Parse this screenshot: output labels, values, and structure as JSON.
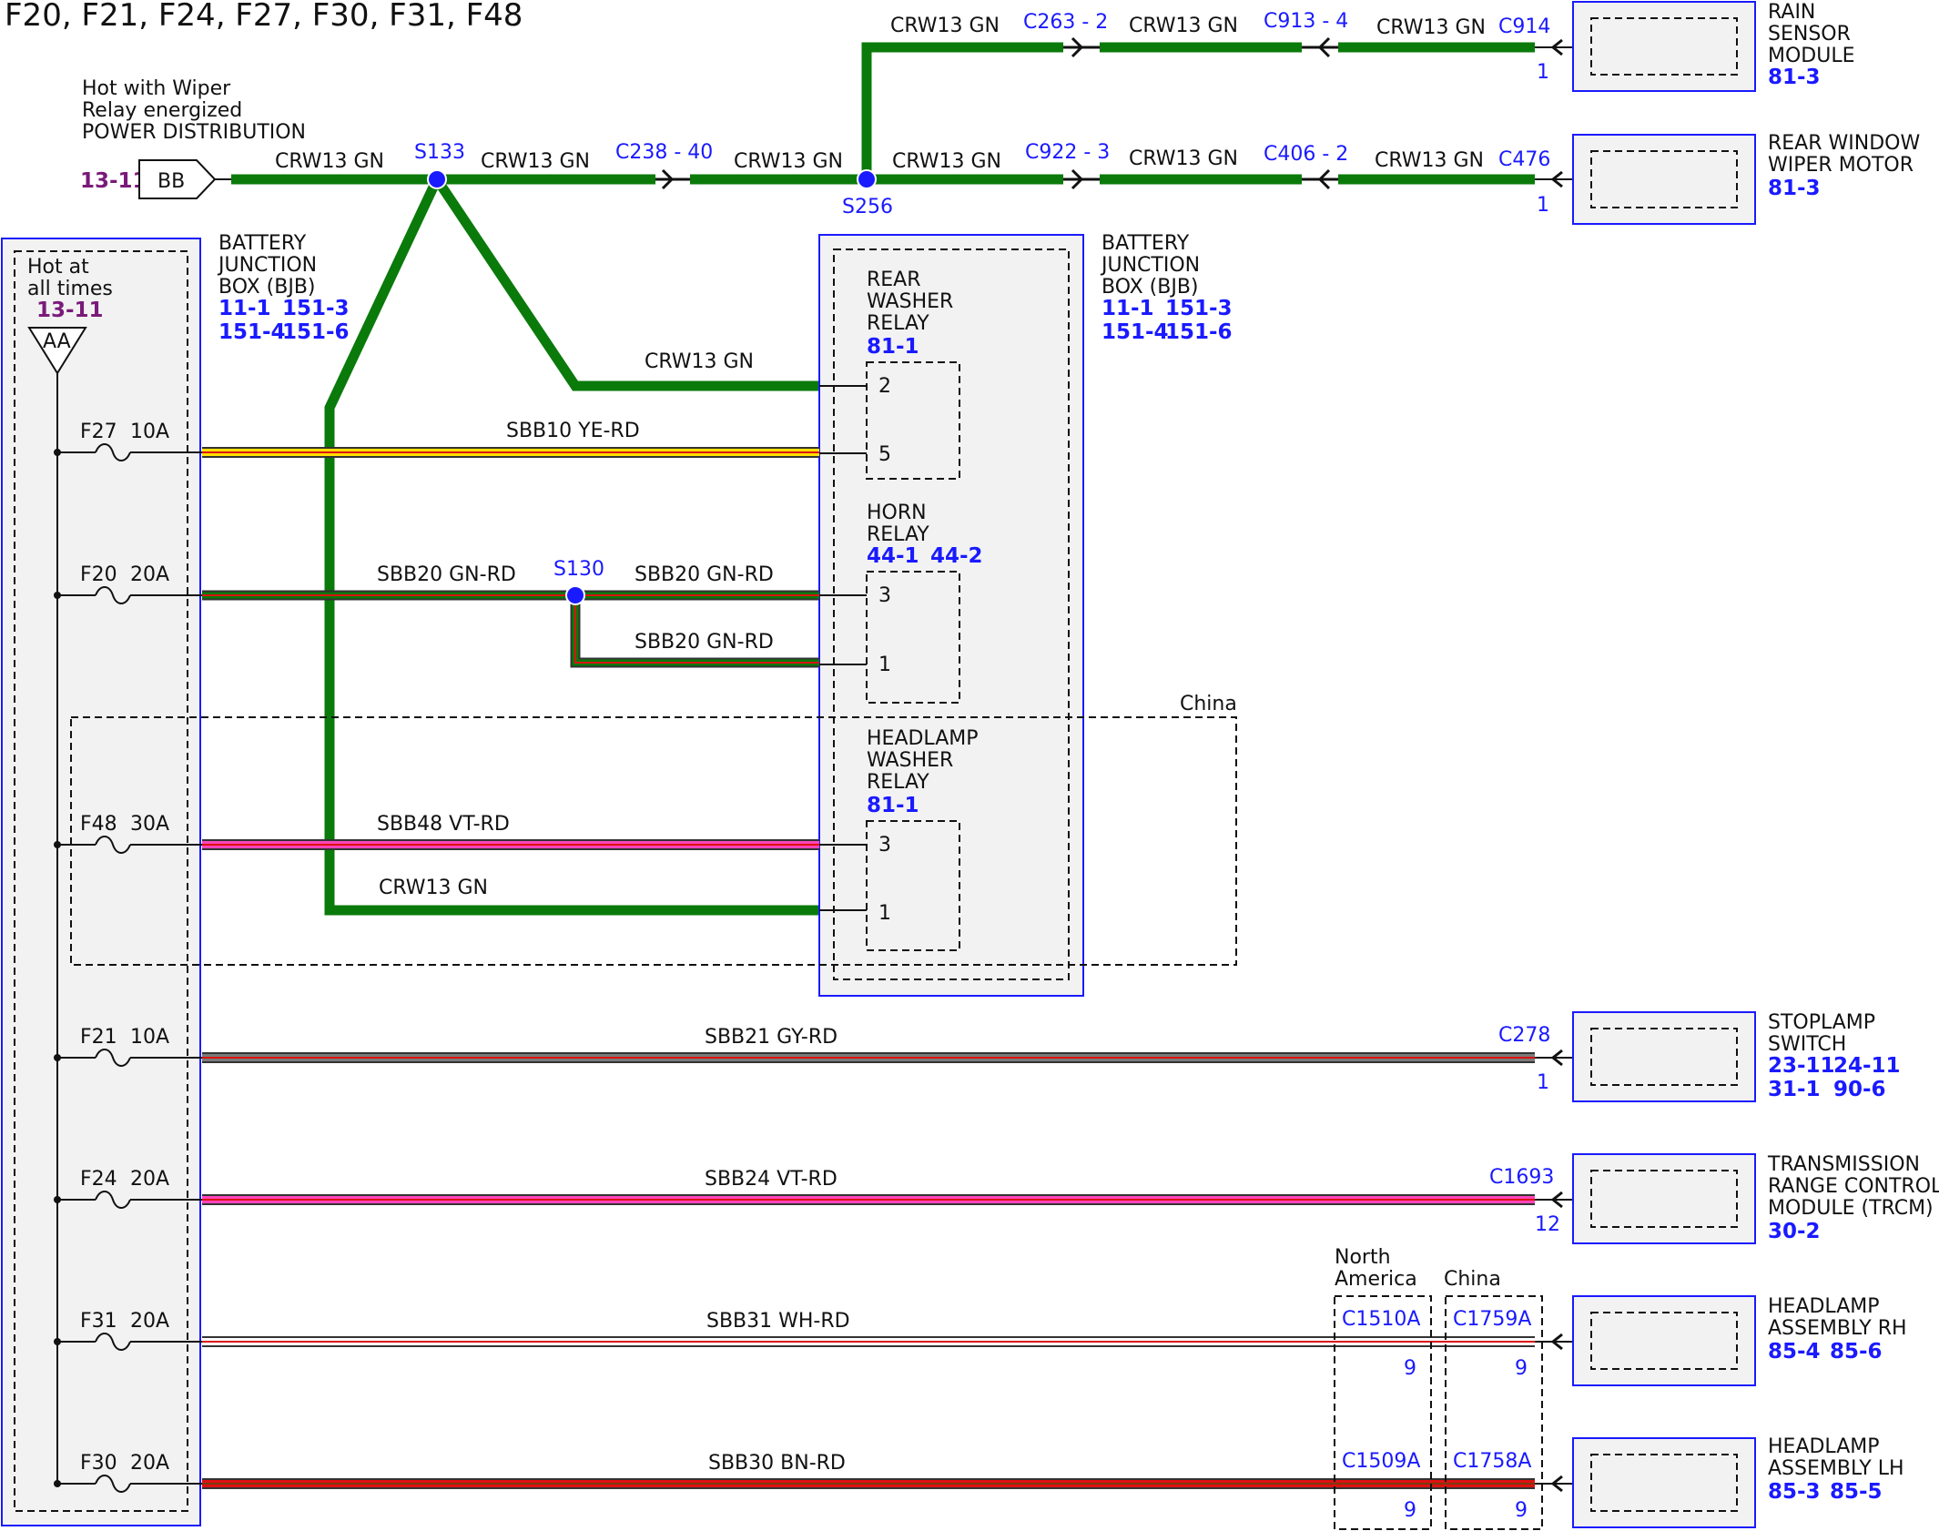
{
  "title": "F20, F21, F24, F27, F30, F31, F48",
  "colors": {
    "gn": "#0a7a0a",
    "ye": "#ffe000",
    "rd": "#dd1111",
    "gy": "#7a7a7a",
    "vt": "#ff44bb",
    "wh": "#ffffff",
    "bn": "#7a3a10",
    "wire_edge": "#333333",
    "splice": "#1a1aff",
    "box_fill": "#f2f2f2",
    "box_edge": "#1a1aff"
  },
  "power_dist": {
    "line1": "Hot with Wiper",
    "line2": "Relay energized",
    "line3": "POWER DISTRIBUTION",
    "ref": "13-11",
    "connector": "BB"
  },
  "bjb_left": {
    "name1": "BATTERY",
    "name2": "JUNCTION",
    "name3": "BOX (BJB)",
    "refs1a": "11-1",
    "refs1b": "151-3",
    "refs2a": "151-4",
    "refs2b": "151-6",
    "hot1": "Hot at",
    "hot2": "all times",
    "hot_ref": "13-11",
    "bus": "AA"
  },
  "bjb_right": {
    "name1": "BATTERY",
    "name2": "JUNCTION",
    "name3": "BOX (BJB)",
    "refs1a": "11-1",
    "refs1b": "151-3",
    "refs2a": "151-4",
    "refs2b": "151-6"
  },
  "fuses": [
    {
      "id": "F27",
      "rating": "10A"
    },
    {
      "id": "F20",
      "rating": "20A"
    },
    {
      "id": "F48",
      "rating": "30A"
    },
    {
      "id": "F21",
      "rating": "10A"
    },
    {
      "id": "F24",
      "rating": "20A"
    },
    {
      "id": "F31",
      "rating": "20A"
    },
    {
      "id": "F30",
      "rating": "20A"
    }
  ],
  "wires": {
    "pd_s133": "CRW13 GN",
    "s133_c238": "CRW13 GN",
    "c238_s256": "CRW13 GN",
    "s256_up_c263": "CRW13 GN",
    "c263_c913": "CRW13 GN",
    "c913_c914": "CRW13 GN",
    "s256_c922": "CRW13 GN",
    "c922_c406": "CRW13 GN",
    "c406_c476": "CRW13 GN",
    "s133_rwr": "CRW13 GN",
    "f27": "SBB10  YE-RD",
    "f20": "SBB20  GN-RD",
    "s130_r": "SBB20  GN-RD",
    "s130_down": "SBB20  GN-RD",
    "f48": "SBB48  VT-RD",
    "hwr1": "CRW13 GN",
    "f21": "SBB21  GY-RD",
    "f24": "SBB24  VT-RD",
    "f31": "SBB31  WH-RD",
    "f30": "SBB30  BN-RD"
  },
  "splices": {
    "s133": "S133",
    "s256": "S256",
    "s130": "S130"
  },
  "connectors": {
    "c238": "C238",
    "c238_pin": "40",
    "c263": "C263",
    "c263_pin": "2",
    "c913": "C913",
    "c913_pin": "4",
    "c914": "C914",
    "c914_pin": "1",
    "c922": "C922",
    "c922_pin": "3",
    "c406": "C406",
    "c406_pin": "2",
    "c476": "C476",
    "c476_pin": "1",
    "c278": "C278",
    "c278_pin": "1",
    "c1693": "C1693",
    "c1693_pin": "12",
    "c1510a": "C1510A",
    "c1510a_pin": "9",
    "c1759a": "C1759A",
    "c1759a_pin": "9",
    "c1509a": "C1509A",
    "c1509a_pin": "9",
    "c1758a": "C1758A",
    "c1758a_pin": "9"
  },
  "relays": {
    "rwr": {
      "l1": "REAR",
      "l2": "WASHER",
      "l3": "RELAY",
      "ref": "81-1",
      "pin_a": "2",
      "pin_b": "5"
    },
    "horn": {
      "l1": "HORN",
      "l2": "RELAY",
      "ref_a": "44-1",
      "ref_b": "44-2",
      "pin_a": "3",
      "pin_b": "1"
    },
    "hlw": {
      "l1": "HEADLAMP",
      "l2": "WASHER",
      "l3": "RELAY",
      "ref": "81-1",
      "pin_a": "3",
      "pin_b": "1"
    }
  },
  "components": {
    "rain": {
      "l1": "RAIN",
      "l2": "SENSOR",
      "l3": "MODULE",
      "ref": "81-3"
    },
    "rwm": {
      "l1": "REAR WINDOW",
      "l2": "WIPER MOTOR",
      "ref": "81-3"
    },
    "stop": {
      "l1": "STOPLAMP",
      "l2": "SWITCH",
      "refs1a": "23-11",
      "refs1b": "24-11",
      "refs2a": "31-1",
      "refs2b": "90-6"
    },
    "trcm": {
      "l1": "TRANSMISSION",
      "l2": "RANGE CONTROL",
      "l3": "MODULE (TRCM)",
      "ref": "30-2"
    },
    "hlrh": {
      "l1": "HEADLAMP",
      "l2": "ASSEMBLY RH",
      "ref_a": "85-4",
      "ref_b": "85-6"
    },
    "hllh": {
      "l1": "HEADLAMP",
      "l2": "ASSEMBLY LH",
      "ref_a": "85-3",
      "ref_b": "85-5"
    }
  },
  "regions": {
    "china": "China",
    "north_america1": "North",
    "north_america2": "America",
    "china2": "China"
  }
}
